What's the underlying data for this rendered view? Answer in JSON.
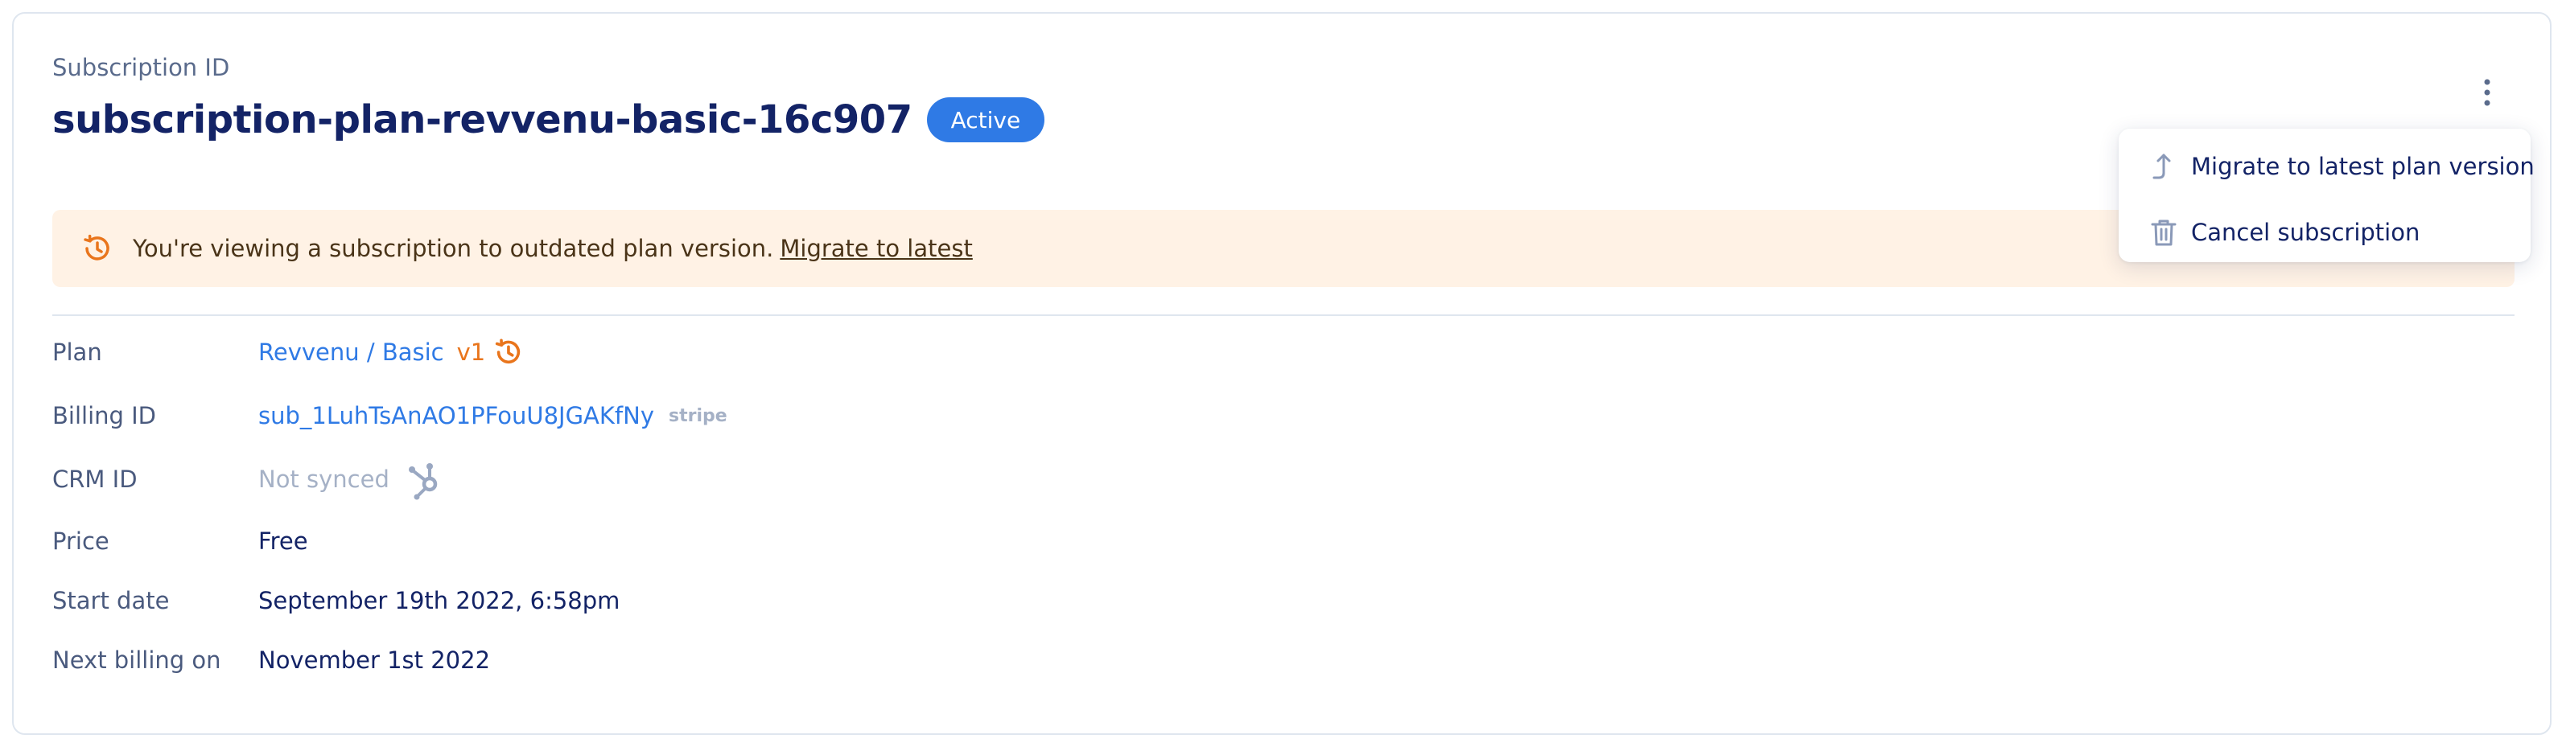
{
  "header": {
    "label": "Subscription ID",
    "title": "subscription-plan-revvenu-basic-16c907",
    "status": "Active"
  },
  "banner": {
    "text": "You're viewing a subscription to outdated plan version.",
    "link": "Migrate to latest",
    "icon": "history-icon"
  },
  "details": {
    "plan": {
      "label": "Plan",
      "value": "Revvenu / Basic",
      "version": "v1"
    },
    "billing": {
      "label": "Billing ID",
      "value": "sub_1LuhTsAnAO1PFouU8JGAKfNy",
      "provider": "stripe"
    },
    "crm": {
      "label": "CRM ID",
      "value": "Not synced",
      "icon": "hubspot-icon"
    },
    "price": {
      "label": "Price",
      "value": "Free"
    },
    "start": {
      "label": "Start date",
      "value": "September 19th 2022, 6:58pm"
    },
    "next": {
      "label": "Next billing on",
      "value": "November 1st 2022"
    }
  },
  "menu": {
    "items": [
      {
        "label": "Migrate to latest plan version",
        "icon": "migrate-arrow-icon"
      },
      {
        "label": "Cancel subscription",
        "icon": "trash-icon"
      }
    ]
  },
  "colors": {
    "accent": "#2f7ae5",
    "title": "#132366",
    "warning_bg": "#fff2e5",
    "warning_icon": "#e9751c"
  }
}
